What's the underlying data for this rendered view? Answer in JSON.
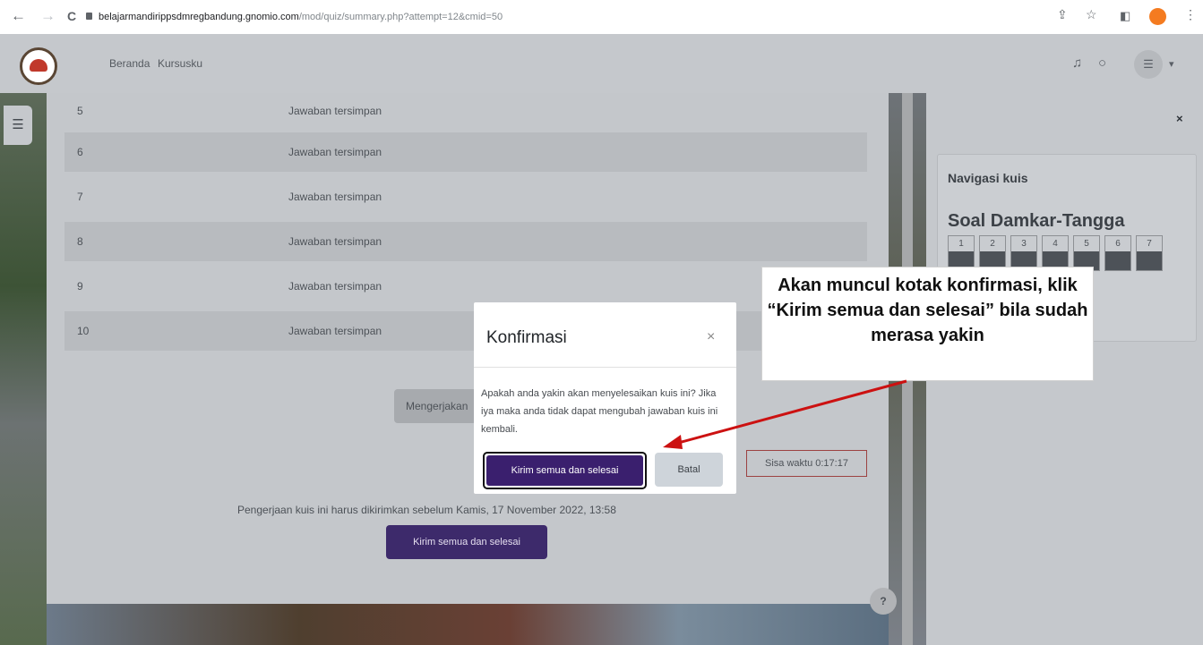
{
  "browser": {
    "back_icon": "←",
    "forward_icon": "→",
    "reload_icon": "C",
    "url_host": "belajarmandirippsdmregbandung.gnomio.com",
    "url_path": "/mod/quiz/summary.php?attempt=12&cmid=50"
  },
  "header": {
    "nav": [
      "Beranda",
      "Kursusku"
    ]
  },
  "summary": {
    "rows": [
      {
        "num": "5",
        "status": "Jawaban tersimpan"
      },
      {
        "num": "6",
        "status": "Jawaban tersimpan"
      },
      {
        "num": "7",
        "status": "Jawaban tersimpan"
      },
      {
        "num": "8",
        "status": "Jawaban tersimpan"
      },
      {
        "num": "9",
        "status": "Jawaban tersimpan"
      },
      {
        "num": "10",
        "status": "Jawaban tersimpan"
      }
    ],
    "continue_label": "Mengerjakan",
    "timer": "Sisa waktu 0:17:17",
    "deadline": "Pengerjaan kuis ini harus dikirimkan sebelum Kamis, 17 November 2022, 13:58",
    "submit_label": "Kirim semua dan selesai",
    "help_label": "?"
  },
  "drawer": {
    "close": "×",
    "nav_title": "Navigasi kuis",
    "quiz_name": "Soal Damkar-Tangga",
    "questions": [
      "1",
      "2",
      "3",
      "4",
      "5",
      "6",
      "7"
    ]
  },
  "modal": {
    "title": "Konfirmasi",
    "close": "×",
    "body": "Apakah anda yakin akan menyelesaikan kuis ini? Jika iya maka anda tidak dapat mengubah jawaban kuis ini kembali.",
    "confirm_label": "Kirim semua dan selesai",
    "cancel_label": "Batal"
  },
  "annotation": {
    "text": "Akan muncul kotak konfirmasi, klik “Kirim semua dan selesai” bila sudah merasa yakin",
    "arrow_color": "#cc1111"
  }
}
